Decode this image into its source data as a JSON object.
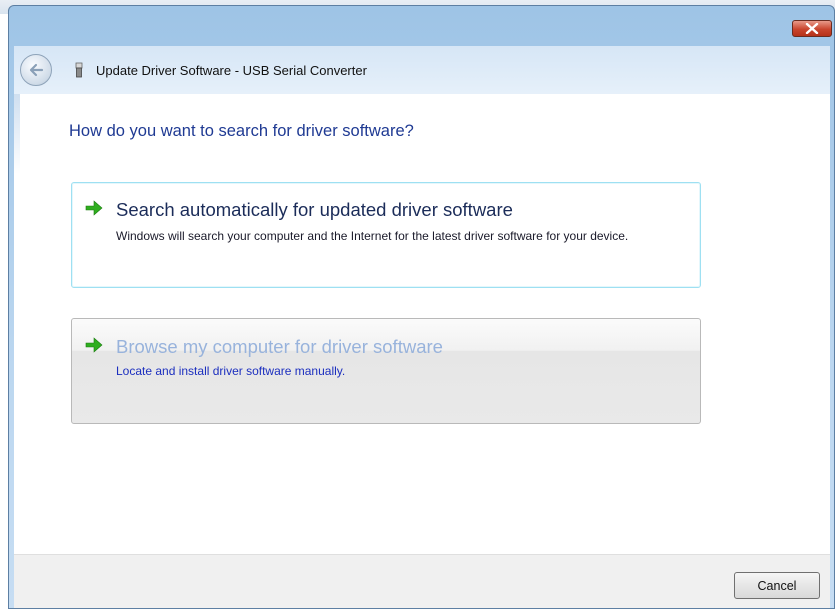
{
  "window": {
    "title": "Update Driver Software - USB Serial Converter"
  },
  "titlebar": {
    "close_icon": "close-icon",
    "back_icon": "back-arrow-icon",
    "device_icon": "usb-device-icon"
  },
  "main": {
    "question": "How do you want to search for driver software?",
    "options": [
      {
        "title": "Search automatically for updated driver software",
        "description": "Windows will search your computer and the Internet for the latest driver software for your device.",
        "icon": "green-arrow-icon"
      },
      {
        "title": "Browse my computer for driver software",
        "description": "Locate and install driver software manually.",
        "icon": "green-arrow-icon"
      }
    ]
  },
  "footer": {
    "cancel_label": "Cancel"
  },
  "colors": {
    "accent_blue": "#1f3a93",
    "arrow_green": "#2fae1f",
    "hover_border": "#9ee0f2"
  }
}
